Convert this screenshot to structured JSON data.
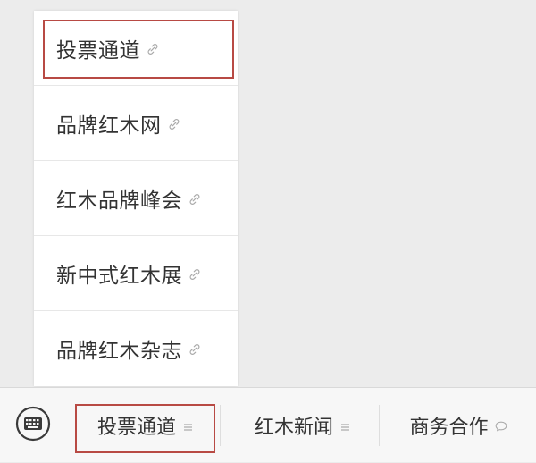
{
  "submenu": {
    "items": [
      {
        "label": "投票通道",
        "icon": "link-icon"
      },
      {
        "label": "品牌红木网",
        "icon": "link-icon"
      },
      {
        "label": "红木品牌峰会",
        "icon": "link-icon"
      },
      {
        "label": "新中式红木展",
        "icon": "link-icon"
      },
      {
        "label": "品牌红木杂志",
        "icon": "link-icon"
      }
    ],
    "selected_index": 0
  },
  "menubar": {
    "keyboard_icon": "keyboard-icon",
    "tabs": [
      {
        "label": "投票通道",
        "icon": "menu-lines-icon"
      },
      {
        "label": "红木新闻",
        "icon": "menu-lines-icon"
      },
      {
        "label": "商务合作",
        "icon": "chat-bubble-icon"
      }
    ],
    "selected_index": 0
  },
  "colors": {
    "highlight": "#b84a44",
    "text": "#333333",
    "icon": "#aaaaaa",
    "background": "#ececec",
    "menubar": "#f7f7f7"
  }
}
